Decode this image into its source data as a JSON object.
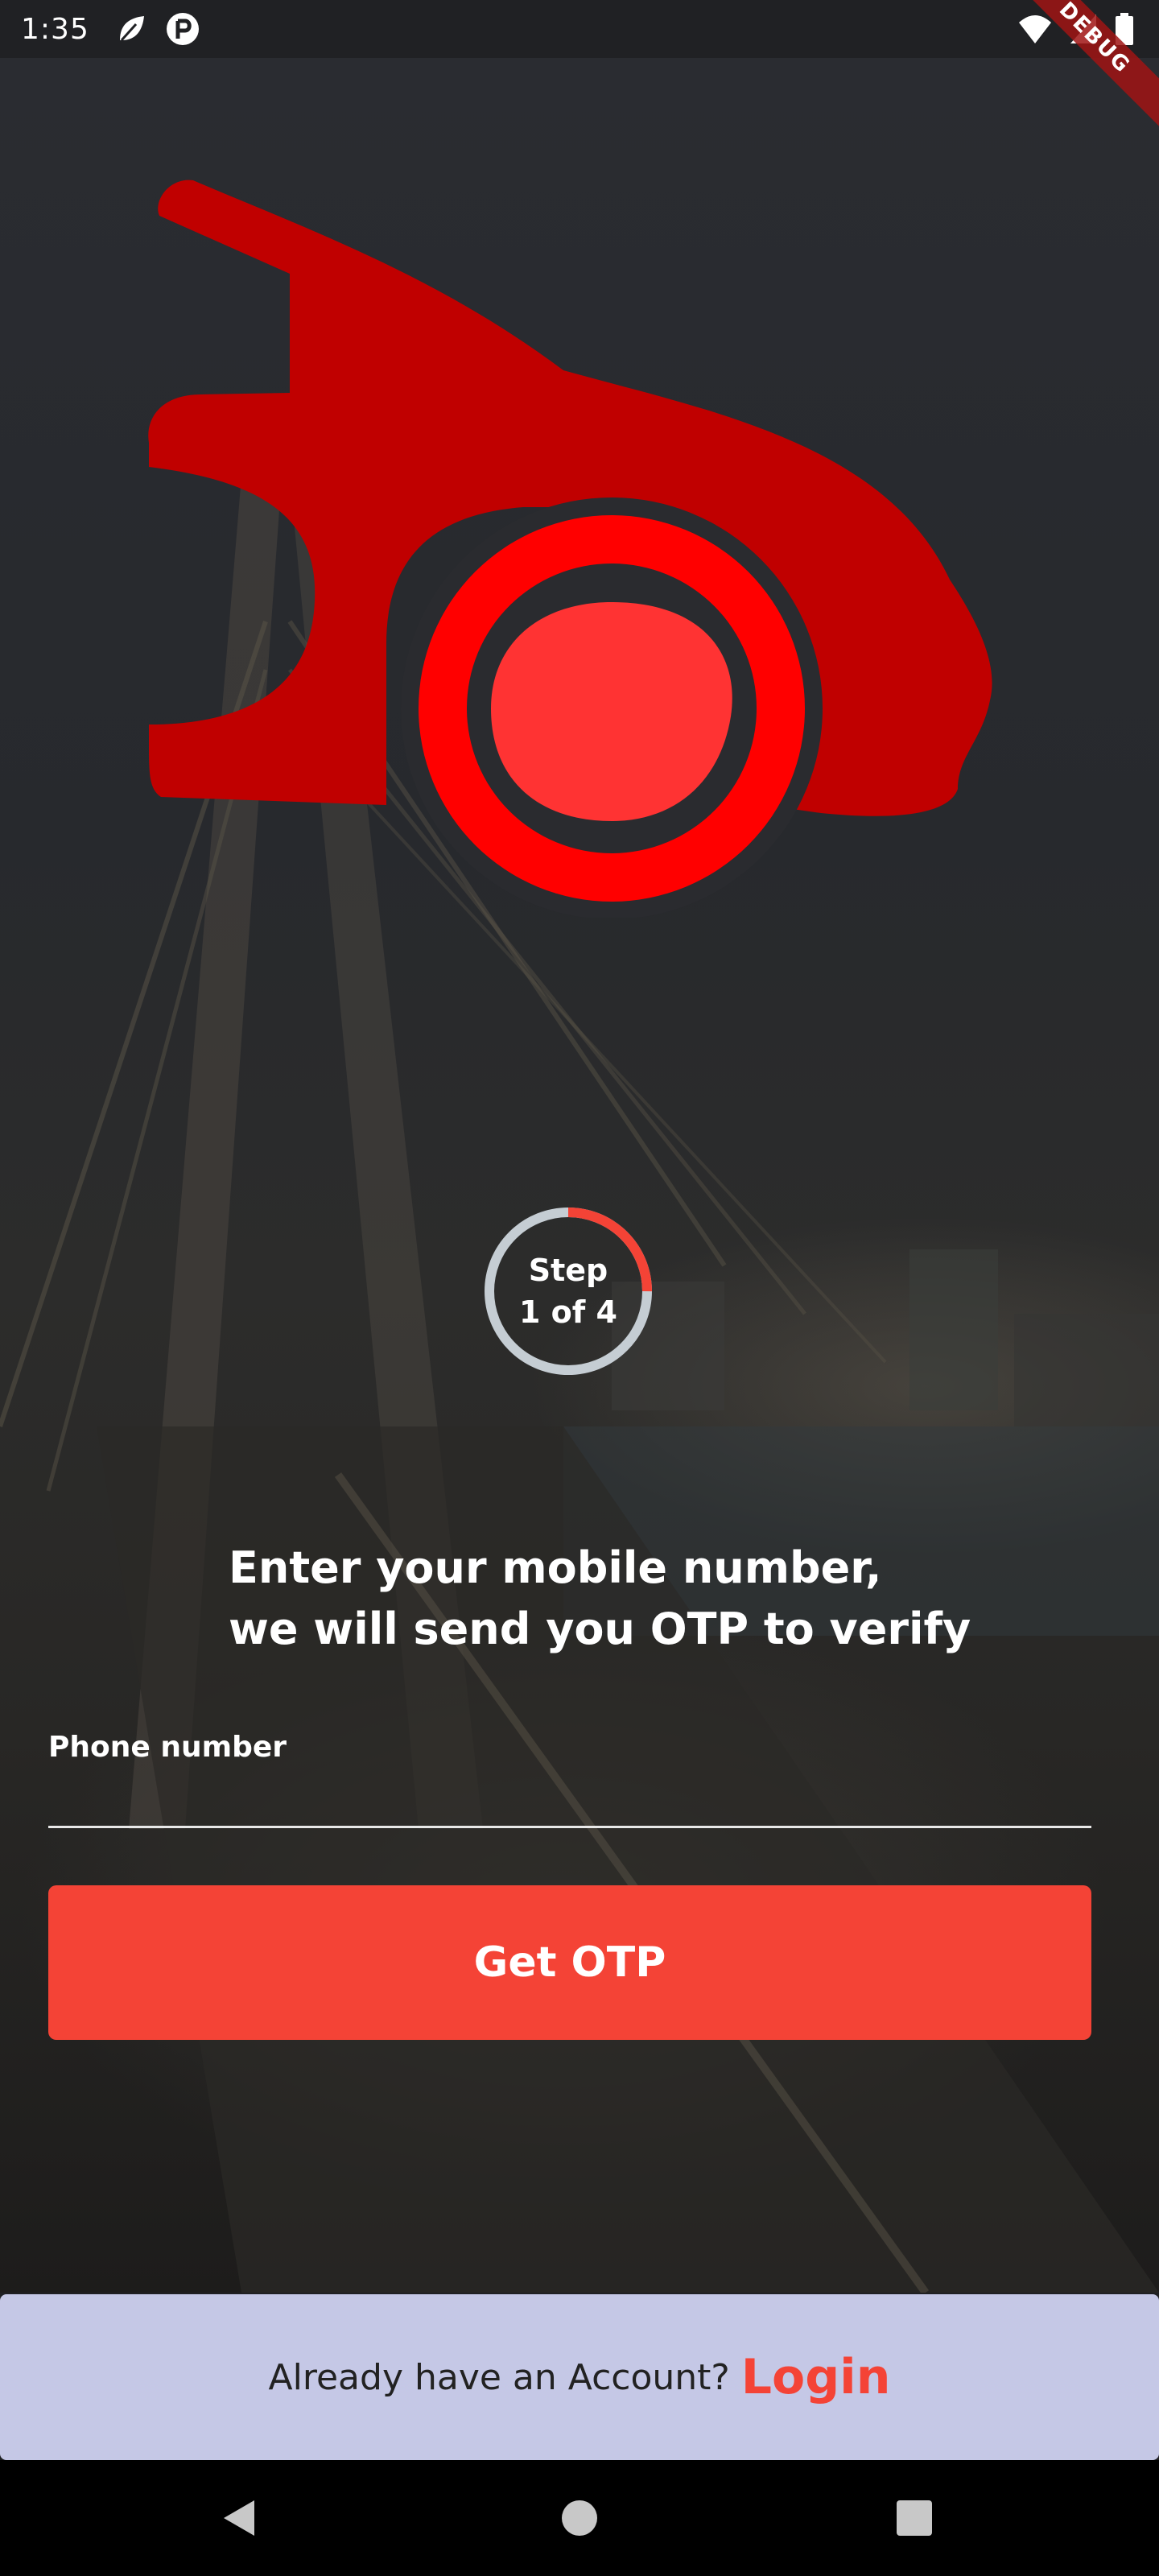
{
  "status_bar": {
    "time": "1:35",
    "left_icons": [
      "leaf-icon",
      "p-badge-icon"
    ],
    "right_icons": [
      "wifi-icon",
      "signal-icon",
      "battery-icon"
    ]
  },
  "debug_banner": "DEBUG",
  "logo": {
    "icon": "car-logo-icon",
    "color": "#c00000",
    "wheel_color": "#ff0000",
    "hub_color": "#ff3333"
  },
  "step": {
    "line1": "Step",
    "line2": "1 of 4",
    "progress": 0.25,
    "track_color": "#c5cdd3",
    "progress_color": "#f44336"
  },
  "heading": {
    "line1": "Enter your mobile number,",
    "line2": "we will send you OTP to verify"
  },
  "phone_field": {
    "label": "Phone number",
    "value": "",
    "placeholder": ""
  },
  "otp_button": {
    "label": "Get OTP",
    "color": "#f44336"
  },
  "footer": {
    "prompt": "Already have an Account?",
    "login_label": "Login",
    "background": "#c5c8e6"
  },
  "nav_bar": {
    "buttons": [
      "back-icon",
      "home-icon",
      "recents-icon"
    ]
  }
}
